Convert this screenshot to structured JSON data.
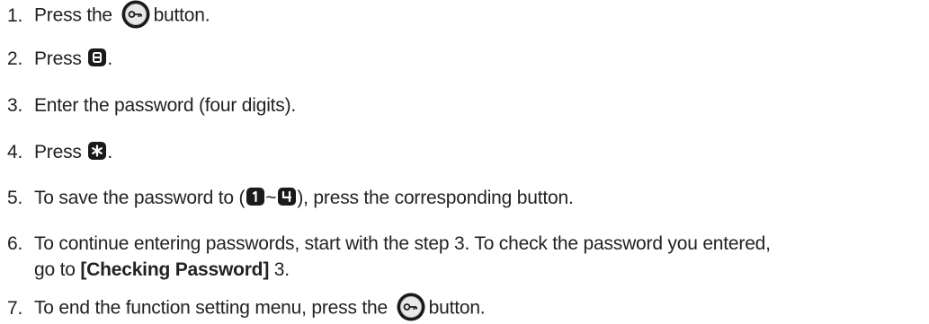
{
  "steps": [
    {
      "num": "1.",
      "pre": "Press the",
      "post": "button."
    },
    {
      "num": "2.",
      "pre": "Press",
      "post": "."
    },
    {
      "num": "3.",
      "text": "Enter the password (four digits)."
    },
    {
      "num": "4.",
      "pre": "Press",
      "post": "."
    },
    {
      "num": "5.",
      "pre": "To save the password to (",
      "sep": "~",
      "post": "), press the corresponding button."
    },
    {
      "num": "6.",
      "text": "To continue entering passwords, start with the step 3. To check the password you entered,",
      "cont_pre": "go to",
      "cont_bold": "[Checking Password]",
      "cont_post": "3."
    },
    {
      "num": "7.",
      "pre": "To end the function setting menu, press the",
      "post": "button."
    }
  ],
  "icons": {
    "function_key": "key-round-icon",
    "key_b": "key-8-icon",
    "key_star": "key-star-icon",
    "key_1": "key-1-icon",
    "key_4": "key-4-icon"
  },
  "colors": {
    "text": "#222222",
    "key_fill": "#1a1a1a",
    "key_ring": "#2a8a96"
  }
}
